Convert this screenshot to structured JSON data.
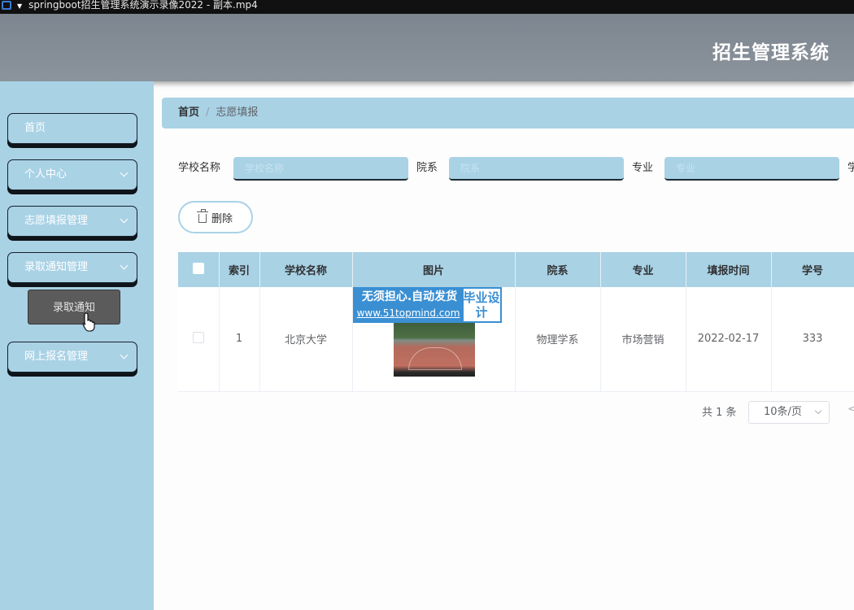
{
  "window": {
    "title": "springboot招生管理系统演示录像2022 - 副本.mp4"
  },
  "header": {
    "title": "招生管理系统"
  },
  "sidebar": {
    "items": [
      {
        "label": "首页"
      },
      {
        "label": "个人中心"
      },
      {
        "label": "志愿填报管理"
      },
      {
        "label": "录取通知管理"
      },
      {
        "label": "网上报名管理"
      }
    ],
    "submenu": {
      "label": "录取通知"
    }
  },
  "breadcrumb": {
    "home": "首页",
    "separator": "/",
    "current": "志愿填报"
  },
  "search": {
    "school_label": "学校名称",
    "school_placeholder": "学校名称",
    "dept_label": "院系",
    "dept_placeholder": "院系",
    "major_label": "专业",
    "major_placeholder": "专业",
    "next_label": "学"
  },
  "actions": {
    "delete_label": "删除"
  },
  "table": {
    "headers": [
      "索引",
      "学校名称",
      "图片",
      "院系",
      "专业",
      "填报时间",
      "学号"
    ],
    "rows": [
      {
        "index": "1",
        "school": "北京大学",
        "dept": "物理学系",
        "major": "市场营销",
        "date": "2022-02-17",
        "student_no": "333"
      }
    ],
    "watermark": {
      "line1": "无须担心.自动发货",
      "line2": "www.51topmind.com",
      "side": "毕业设计"
    }
  },
  "pagination": {
    "total": "共 1 条",
    "page_size": "10条/页",
    "prev": "<"
  },
  "colors": {
    "sidebar": "#a9d2e5",
    "header": "#848c95",
    "submenu": "#5b5b5b"
  }
}
